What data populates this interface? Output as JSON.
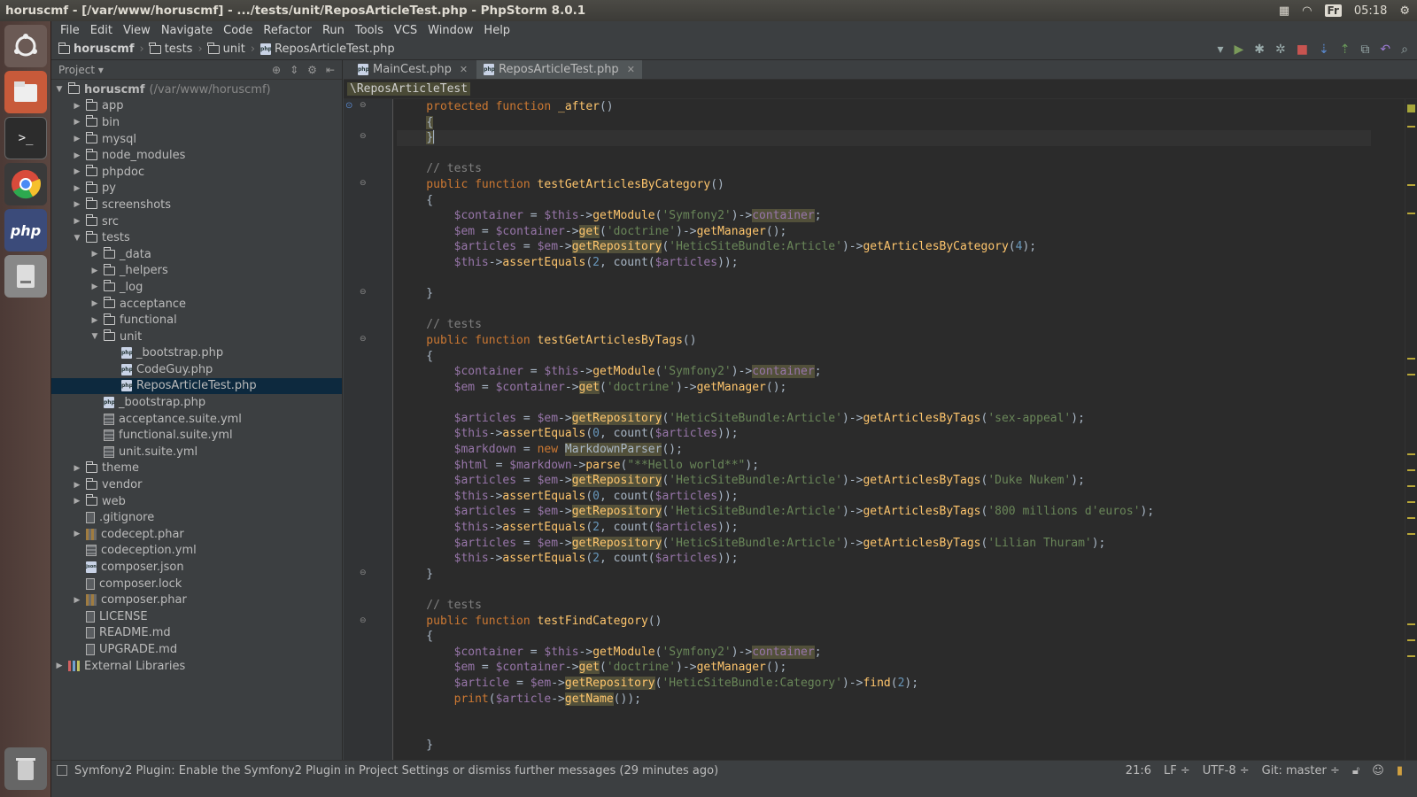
{
  "window": {
    "title": "horuscmf - [/var/www/horuscmf] - .../tests/unit/ReposArticleTest.php - PhpStorm 8.0.1",
    "keyboard_layout": "Fr",
    "clock": "05:18"
  },
  "menu": [
    "File",
    "Edit",
    "View",
    "Navigate",
    "Code",
    "Refactor",
    "Run",
    "Tools",
    "VCS",
    "Window",
    "Help"
  ],
  "breadcrumb": [
    "horuscmf",
    "tests",
    "unit",
    "ReposArticleTest.php"
  ],
  "project_panel": {
    "title": "Project",
    "root_label": "horuscmf",
    "root_path": "(/var/www/horuscmf)",
    "items": [
      {
        "label": "app"
      },
      {
        "label": "bin"
      },
      {
        "label": "mysql"
      },
      {
        "label": "node_modules"
      },
      {
        "label": "phpdoc"
      },
      {
        "label": "py"
      },
      {
        "label": "screenshots"
      },
      {
        "label": "src"
      },
      {
        "label": "tests"
      },
      {
        "label": "_data"
      },
      {
        "label": "_helpers"
      },
      {
        "label": "_log"
      },
      {
        "label": "acceptance"
      },
      {
        "label": "functional"
      },
      {
        "label": "unit"
      },
      {
        "label": "_bootstrap.php"
      },
      {
        "label": "CodeGuy.php"
      },
      {
        "label": "ReposArticleTest.php"
      },
      {
        "label": "_bootstrap.php"
      },
      {
        "label": "acceptance.suite.yml"
      },
      {
        "label": "functional.suite.yml"
      },
      {
        "label": "unit.suite.yml"
      },
      {
        "label": "theme"
      },
      {
        "label": "vendor"
      },
      {
        "label": "web"
      },
      {
        "label": ".gitignore"
      },
      {
        "label": "codecept.phar"
      },
      {
        "label": "codeception.yml"
      },
      {
        "label": "composer.json"
      },
      {
        "label": "composer.lock"
      },
      {
        "label": "composer.phar"
      },
      {
        "label": "LICENSE"
      },
      {
        "label": "README.md"
      },
      {
        "label": "UPGRADE.md"
      },
      {
        "label": "External Libraries"
      }
    ]
  },
  "tabs": [
    {
      "label": "MainCest.php",
      "active": false
    },
    {
      "label": "ReposArticleTest.php",
      "active": true
    }
  ],
  "class_crumb": "\\ReposArticleTest",
  "code_lines": [
    "    protected function _after()",
    "    {",
    "    }",
    "",
    "    // tests",
    "    public function testGetArticlesByCategory()",
    "    {",
    "        $container = $this->getModule('Symfony2')->container;",
    "        $em = $container->get('doctrine')->getManager();",
    "        $articles = $em->getRepository('HeticSiteBundle:Article')->getArticlesByCategory(4);",
    "        $this->assertEquals(2, count($articles));",
    "",
    "    }",
    "",
    "    // tests",
    "    public function testGetArticlesByTags()",
    "    {",
    "        $container = $this->getModule('Symfony2')->container;",
    "        $em = $container->get('doctrine')->getManager();",
    "",
    "        $articles = $em->getRepository('HeticSiteBundle:Article')->getArticlesByTags('sex-appeal');",
    "        $this->assertEquals(0, count($articles));",
    "        $markdown = new MarkdownParser();",
    "        $html = $markdown->parse(\"**Hello world**\");",
    "        $articles = $em->getRepository('HeticSiteBundle:Article')->getArticlesByTags('Duke Nukem');",
    "        $this->assertEquals(0, count($articles));",
    "        $articles = $em->getRepository('HeticSiteBundle:Article')->getArticlesByTags('800 millions d'euros');",
    "        $this->assertEquals(2, count($articles));",
    "        $articles = $em->getRepository('HeticSiteBundle:Article')->getArticlesByTags('Lilian Thuram');",
    "        $this->assertEquals(2, count($articles));",
    "    }",
    "",
    "    // tests",
    "    public function testFindCategory()",
    "    {",
    "        $container = $this->getModule('Symfony2')->container;",
    "        $em = $container->get('doctrine')->getManager();",
    "        $article = $em->getRepository('HeticSiteBundle:Category')->find(2);",
    "        print($article->getName());",
    "",
    "",
    "    }"
  ],
  "status": {
    "message": "Symfony2 Plugin: Enable the Symfony2 Plugin in Project Settings or dismiss further messages (29 minutes ago)",
    "position": "21:6",
    "line_sep": "LF ÷",
    "encoding": "UTF-8 ÷",
    "vcs": "Git: master ÷"
  }
}
